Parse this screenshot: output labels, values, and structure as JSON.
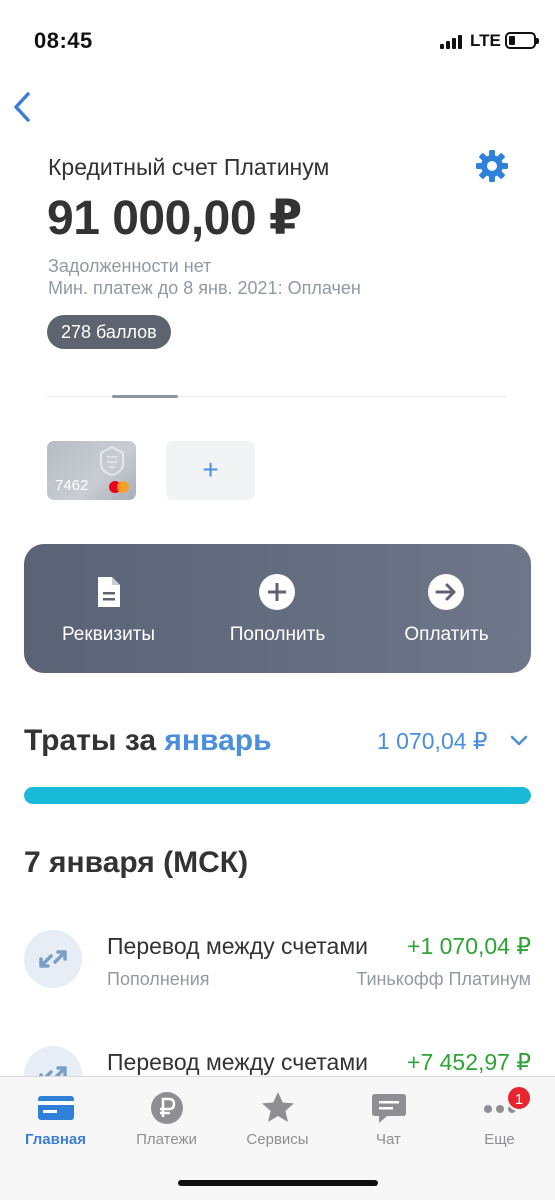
{
  "status_bar": {
    "time": "08:45",
    "network": "LTE"
  },
  "account": {
    "name": "Кредитный счет Платинум",
    "balance": "91 000,00 ₽",
    "debt_status": "Задолженности нет",
    "min_payment": "Мин. платеж до 8 янв. 2021: Оплачен",
    "points": "278 баллов"
  },
  "cards": [
    {
      "last_digits": "7462"
    }
  ],
  "add_card_label": "+",
  "actions": {
    "details": "Реквизиты",
    "top_up": "Пополнить",
    "pay": "Оплатить"
  },
  "spending": {
    "title_prefix": "Траты за",
    "month": "январь",
    "total": "1 070,04 ₽",
    "progress_fraction": 1.0
  },
  "date_header": "7 января (МСК)",
  "transactions": [
    {
      "title": "Перевод между счетами",
      "amount": "+1 070,04 ₽",
      "category": "Пополнения",
      "account": "Тинькофф Платинум"
    },
    {
      "title": "Перевод между счетами",
      "amount": "+7 452,97 ₽",
      "category": "",
      "account": ""
    }
  ],
  "tabs": [
    {
      "label": "Главная",
      "icon": "card-icon",
      "active": true
    },
    {
      "label": "Платежи",
      "icon": "ruble-icon"
    },
    {
      "label": "Сервисы",
      "icon": "star-icon"
    },
    {
      "label": "Чат",
      "icon": "chat-icon"
    },
    {
      "label": "Еще",
      "icon": "more-icon",
      "badge": "1"
    }
  ],
  "colors": {
    "accent_blue": "#4a8fdb",
    "income_green": "#2ea336",
    "progress_cyan": "#19b9d8",
    "panel_gray": "#5d6470",
    "badge_red": "#e8252e"
  }
}
